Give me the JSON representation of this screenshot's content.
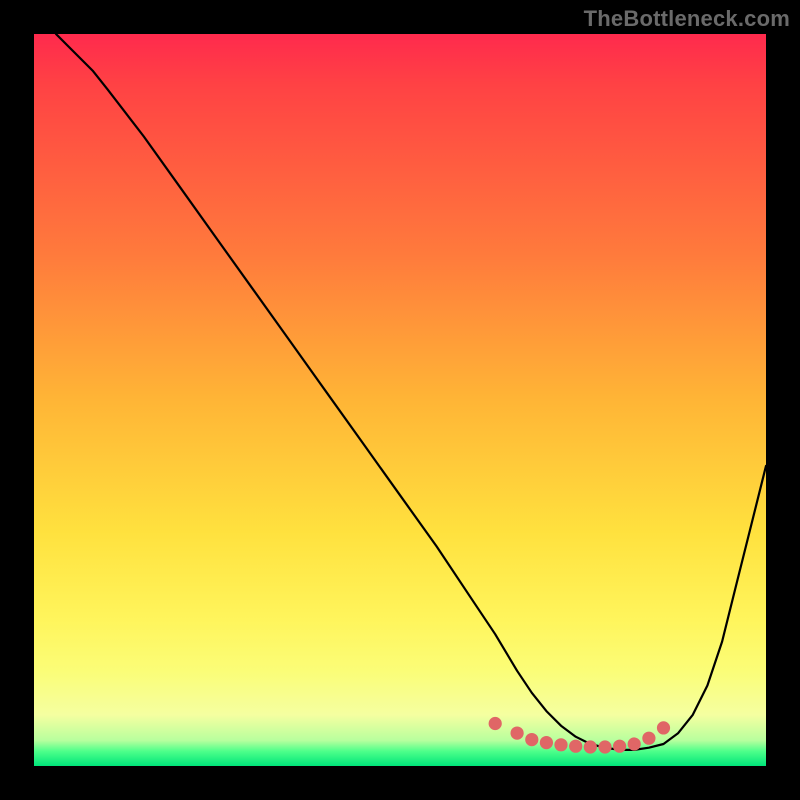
{
  "watermark": "TheBottleneck.com",
  "chart_data": {
    "type": "line",
    "title": "",
    "xlabel": "",
    "ylabel": "",
    "xlim": [
      0,
      100
    ],
    "ylim": [
      0,
      100
    ],
    "grid": false,
    "legend": false,
    "note": "Single unlabeled curve on a color gradient. x is horizontal position as % of plot width, y is vertical height as % of plot height (0 = bottom, 100 = top). Values estimated from pixels.",
    "series": [
      {
        "name": "curve",
        "color": "#000000",
        "x": [
          3,
          5,
          8,
          10,
          15,
          20,
          25,
          30,
          35,
          40,
          45,
          50,
          55,
          60,
          63,
          66,
          68,
          70,
          72,
          74,
          76,
          78,
          80,
          82,
          84,
          86,
          88,
          90,
          92,
          94,
          96,
          98,
          100
        ],
        "y": [
          100,
          98,
          95,
          92.5,
          86,
          79,
          72,
          65,
          58,
          51,
          44,
          37,
          30,
          22.5,
          18,
          13,
          10,
          7.5,
          5.5,
          4,
          3,
          2.5,
          2.2,
          2.2,
          2.5,
          3,
          4.5,
          7,
          11,
          17,
          25,
          33,
          41
        ]
      }
    ],
    "markers": {
      "color": "#e06666",
      "radius_pct": 0.9,
      "shape": "circle",
      "x": [
        63,
        66,
        68,
        70,
        72,
        74,
        76,
        78,
        80,
        82,
        84,
        86
      ],
      "y": [
        5.8,
        4.5,
        3.6,
        3.2,
        2.9,
        2.7,
        2.6,
        2.6,
        2.7,
        3.0,
        3.8,
        5.2
      ]
    }
  }
}
